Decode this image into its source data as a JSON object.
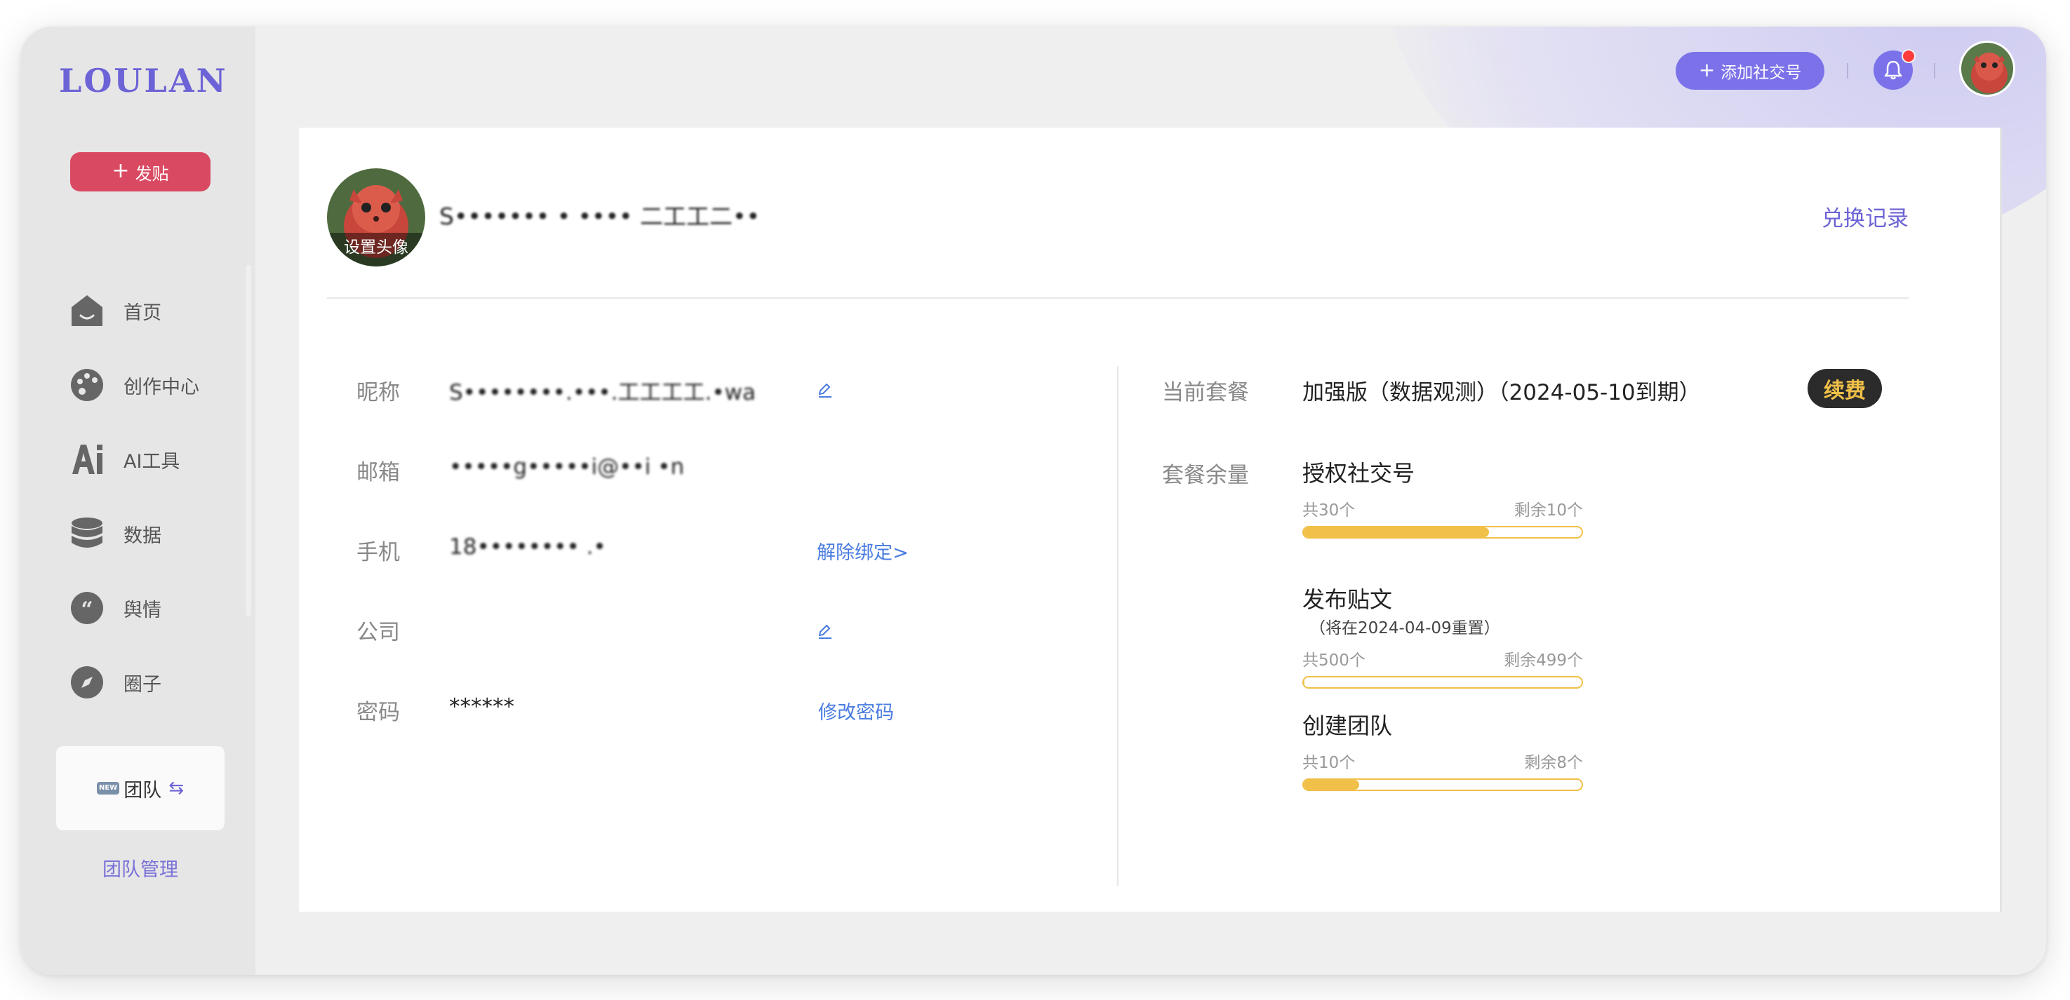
{
  "sidebar": {
    "logo": "LOULAN",
    "post_button": "发贴",
    "nav": [
      {
        "label": "首页",
        "icon": "home-icon"
      },
      {
        "label": "创作中心",
        "icon": "palette-icon"
      },
      {
        "label": "AI工具",
        "icon": "ai-icon"
      },
      {
        "label": "数据",
        "icon": "database-icon"
      },
      {
        "label": "舆情",
        "icon": "quote-icon"
      },
      {
        "label": "圈子",
        "icon": "compass-icon"
      }
    ],
    "team_badge": "NEW",
    "team_label": "团队",
    "team_manage": "团队管理"
  },
  "topbar": {
    "add_social_account": "添加社交号"
  },
  "profile": {
    "avatar_overlay": "设置头像",
    "display_name": "S••••••• • •••• 二工工二••",
    "exchange_record": "兑换记录",
    "fields": {
      "nickname": {
        "label": "昵称",
        "value": "S••••••••.•••.工工工工.•wa"
      },
      "email": {
        "label": "邮箱",
        "value": "•••••g•••••i@••i •n"
      },
      "phone": {
        "label": "手机",
        "value": "18•••••••• .•",
        "action": "解除绑定>"
      },
      "company": {
        "label": "公司",
        "value": ""
      },
      "password": {
        "label": "密码",
        "value": "******",
        "action": "修改密码"
      }
    }
  },
  "plan": {
    "current_label": "当前套餐",
    "current_value": "加强版（数据观测）（2024-05-10到期）",
    "renew_button": "续费",
    "quota_label": "套餐余量",
    "quotas": [
      {
        "title": "授权社交号",
        "note": "",
        "total": "共30个",
        "remaining": "剩余10个",
        "used_fraction": 0.667
      },
      {
        "title": "发布贴文",
        "note": "（将在2024-04-09重置）",
        "total": "共500个",
        "remaining": "剩余499个",
        "used_fraction": 0.002
      },
      {
        "title": "创建团队",
        "note": "",
        "total": "共10个",
        "remaining": "剩余8个",
        "used_fraction": 0.2
      }
    ]
  },
  "colors": {
    "brand": "#6c63d6",
    "post_button": "#d94a62",
    "renew_text": "#f0c048",
    "progress": "#f0c048",
    "link": "#4a7ce0"
  }
}
